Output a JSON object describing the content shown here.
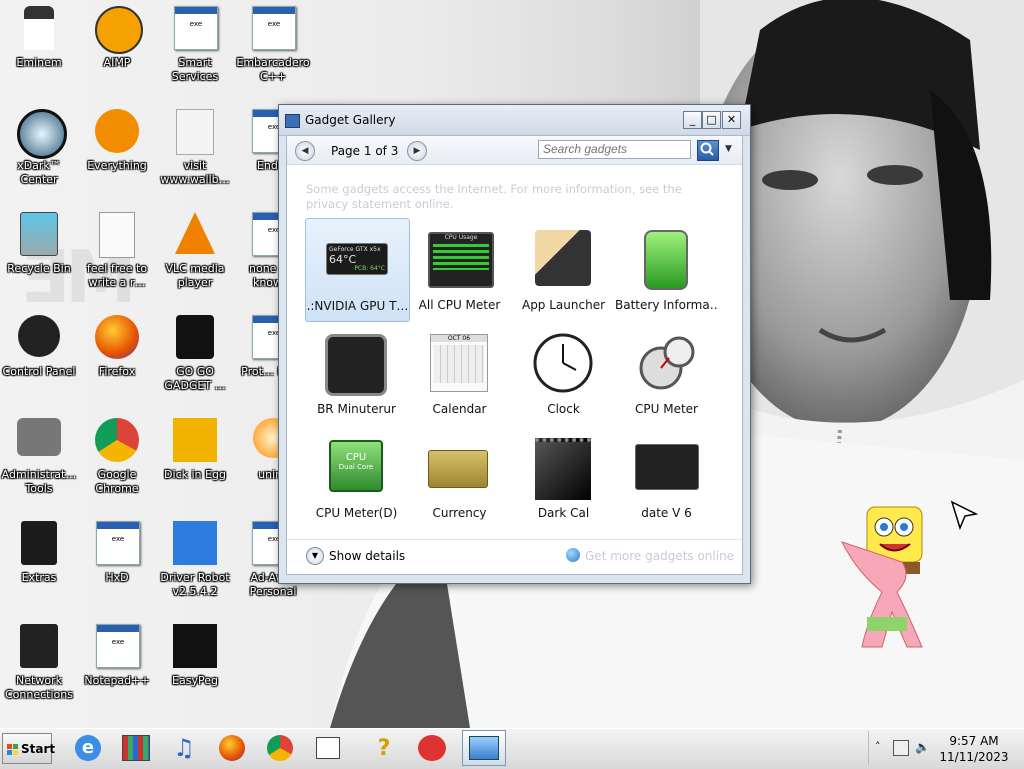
{
  "desktop": {
    "icons": [
      {
        "label": "Eminem"
      },
      {
        "label": "AIMP"
      },
      {
        "label": "Smart Services"
      },
      {
        "label": "Embarcadero C++"
      },
      {
        "label": "xDark™ Center"
      },
      {
        "label": "Everything"
      },
      {
        "label": "visit www.wallb…"
      },
      {
        "label": "Ender"
      },
      {
        "label": "Recycle Bin"
      },
      {
        "label": "feel free to write a r…"
      },
      {
        "label": "VLC media player"
      },
      {
        "label": "none c… know…"
      },
      {
        "label": "Control Panel"
      },
      {
        "label": "Firefox"
      },
      {
        "label": "GO GO GADGET …"
      },
      {
        "label": "Prot… Hack"
      },
      {
        "label": "Administrat… Tools"
      },
      {
        "label": "Google Chrome"
      },
      {
        "label": "Dick in Egg"
      },
      {
        "label": "unins"
      },
      {
        "label": "Extras"
      },
      {
        "label": "HxD"
      },
      {
        "label": "Driver Robot v2.5.4.2"
      },
      {
        "label": "Ad-Aw… Personal"
      },
      {
        "label": "Network Connections"
      },
      {
        "label": "Notepad++"
      },
      {
        "label": "EasyPeg"
      }
    ]
  },
  "gadget_gallery": {
    "title": "Gadget Gallery",
    "page_indicator": "Page 1 of 3",
    "search_placeholder": "Search gadgets",
    "notice": "Some gadgets access the Internet.  For more information, see the privacy statement online.",
    "gadgets": [
      {
        "label": ".:NVIDIA GPU T…",
        "selected": true,
        "icon": "nvidia-gpu-temp-icon",
        "thumb_text": "64°C",
        "thumb_sub": "GeForce GTX x5x",
        "thumb_pcb": "PCB: 64°C"
      },
      {
        "label": "All CPU Meter",
        "icon": "cpu-usage-icon",
        "thumb_text": "CPU Usage"
      },
      {
        "label": "App Launcher",
        "icon": "app-launcher-icon"
      },
      {
        "label": "Battery Informa…",
        "icon": "battery-icon"
      },
      {
        "label": "BR Minuterur",
        "icon": "watch-icon"
      },
      {
        "label": "Calendar",
        "icon": "calendar-icon",
        "thumb_text": "OCT 06"
      },
      {
        "label": "Clock",
        "icon": "clock-icon"
      },
      {
        "label": "CPU Meter",
        "icon": "cpu-meter-icon"
      },
      {
        "label": "CPU Meter(D)",
        "icon": "cpu-chip-icon",
        "thumb_text": "CPU",
        "thumb_sub": "Dual Core"
      },
      {
        "label": "Currency",
        "icon": "currency-icon"
      },
      {
        "label": "Dark Cal",
        "icon": "dark-calendar-icon"
      },
      {
        "label": "date V 6",
        "icon": "date-widget-icon"
      }
    ],
    "show_details": "Show details",
    "get_more_online": "Get more gadgets online"
  },
  "taskbar": {
    "start_label": "Start",
    "items": [
      {
        "icon": "internet-explorer-icon"
      },
      {
        "icon": "archive-icon"
      },
      {
        "icon": "music-note-icon"
      },
      {
        "icon": "firefox-icon"
      },
      {
        "icon": "chrome-icon"
      },
      {
        "icon": "folder-icon"
      },
      {
        "icon": "help-icon"
      },
      {
        "icon": "game-icon"
      },
      {
        "icon": "gadget-gallery-taskbar-icon",
        "active": true
      }
    ],
    "clock_time": "9:57 AM",
    "clock_date": "11/11/2023"
  }
}
